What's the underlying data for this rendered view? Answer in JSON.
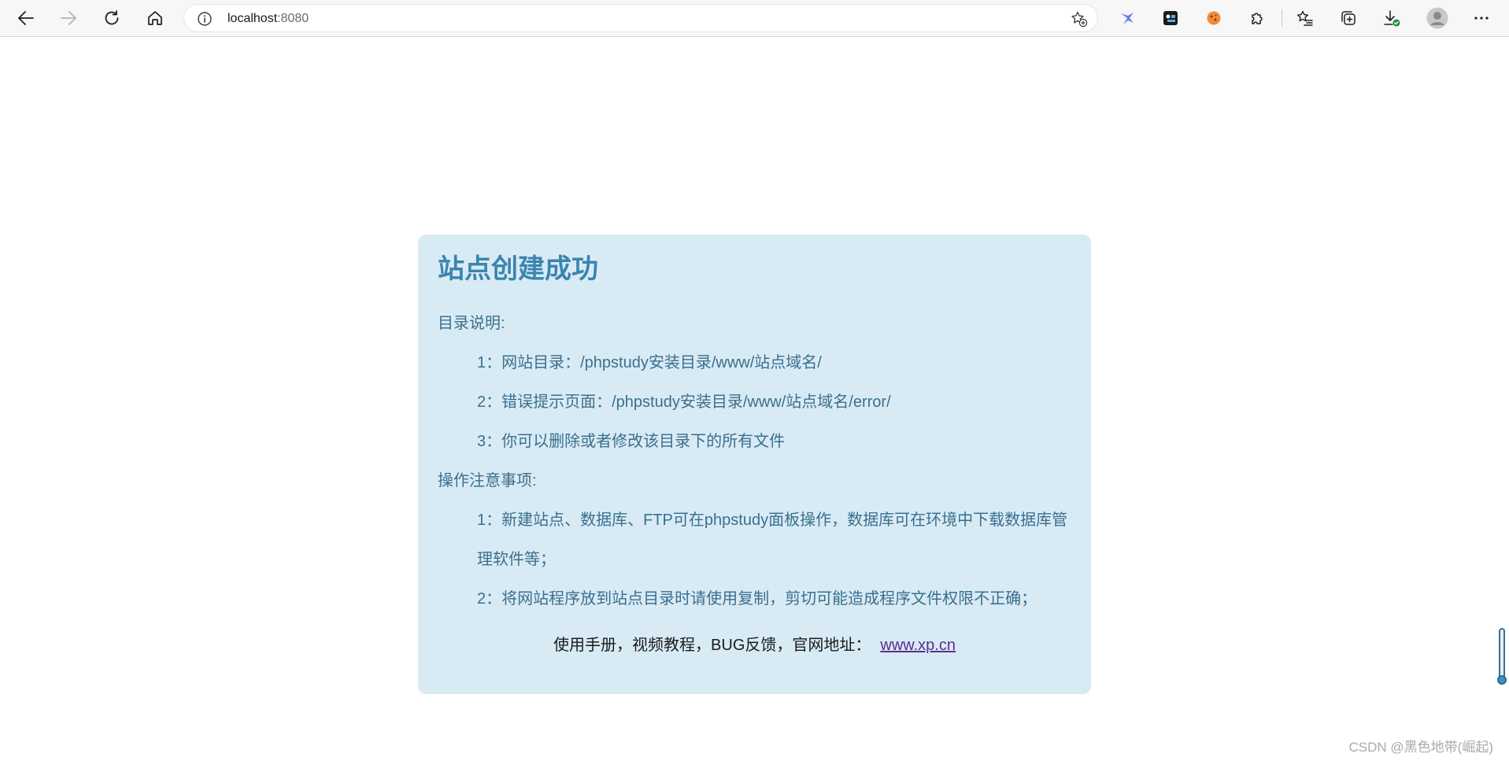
{
  "browser": {
    "url_host": "localhost",
    "url_port": ":8080",
    "icons": {
      "back": "arrow-left-icon",
      "forward": "arrow-right-icon",
      "reload": "reload-icon",
      "home": "home-icon",
      "site_info": "info-circle-icon",
      "add_favorite": "star-plus-icon",
      "extension_1": "bird-extension-icon",
      "extension_2": "console-extension-icon",
      "extension_3": "cookie-extension-icon",
      "extensions": "puzzle-icon",
      "favorites": "star-list-icon",
      "collections": "collections-icon",
      "downloads": "download-icon",
      "profile": "avatar-icon",
      "menu": "ellipsis-icon"
    },
    "colors": {
      "toolbar_bg": "#f7f7f7",
      "address_bg": "#ffffff"
    }
  },
  "page": {
    "title": "站点创建成功",
    "dir_heading": "目录说明:",
    "dir_items": [
      "1：网站目录：/phpstudy安装目录/www/站点域名/",
      "2：错误提示页面：/phpstudy安装目录/www/站点域名/error/",
      "3：你可以删除或者修改该目录下的所有文件"
    ],
    "notes_heading": "操作注意事项:",
    "note_1_line_1": "1：新建站点、数据库、FTP可在phpstudy面板操作，数据库可在环境中下载数据库管",
    "note_1_line_2": "理软件等；",
    "note_2": "2：将网站程序放到站点目录时请使用复制，剪切可能造成程序文件权限不正确；",
    "footer_text": "使用手册，视频教程，BUG反馈，官网地址：",
    "footer_link": "www.xp.cn",
    "colors": {
      "card_bg": "#d8ebf5",
      "title": "#3a85ae",
      "body_text": "#3b6f8e",
      "link": "#5b2e8c"
    }
  },
  "watermark": "CSDN @黑色地带(崛起)"
}
